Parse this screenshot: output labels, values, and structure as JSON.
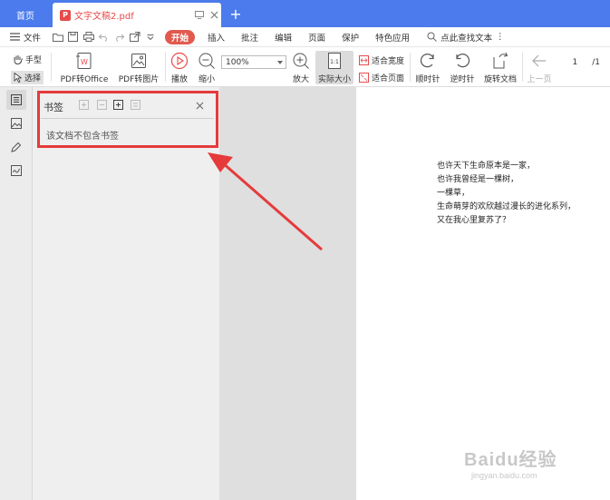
{
  "tabs": {
    "home": "首页",
    "document": "文字文稿2.pdf",
    "new_tab": "+"
  },
  "menu": {
    "file": "文件",
    "start": "开始",
    "insert": "插入",
    "comment": "批注",
    "edit": "编辑",
    "page": "页面",
    "protect": "保护",
    "special": "特色应用",
    "search": "点此查找文本"
  },
  "toolbar": {
    "hand": "手型",
    "select": "选择",
    "pdf_to_office": "PDF转Office",
    "pdf_to_image": "PDF转图片",
    "play": "播放",
    "zoom_out": "缩小",
    "zoom_value": "100%",
    "zoom_in": "放大",
    "actual_size": "实际大小",
    "fit_width": "适合宽度",
    "fit_page": "适合页面",
    "rotate_cw": "顺时针",
    "rotate_ccw": "逆时针",
    "rotate_doc": "旋转文档",
    "prev_page": "上一页",
    "page_number": "1",
    "page_total": "/1"
  },
  "bookmark_panel": {
    "title": "书签",
    "empty_message": "该文档不包含书签"
  },
  "document": {
    "lines": [
      "也许天下生命原本是一家，",
      "也许我曾经是一棵树，",
      "一棵草，",
      "生命萌芽的欢欣越过漫长的进化系列，",
      "又在我心里复苏了？"
    ]
  },
  "watermark": {
    "logo": "Baidu经验",
    "url": "jingyan.baidu.com"
  },
  "colors": {
    "tab_bar": "#4b7bec",
    "highlight": "#e53b3b",
    "start_button": "#e15a4f",
    "pdf_badge": "#e84a4a"
  }
}
